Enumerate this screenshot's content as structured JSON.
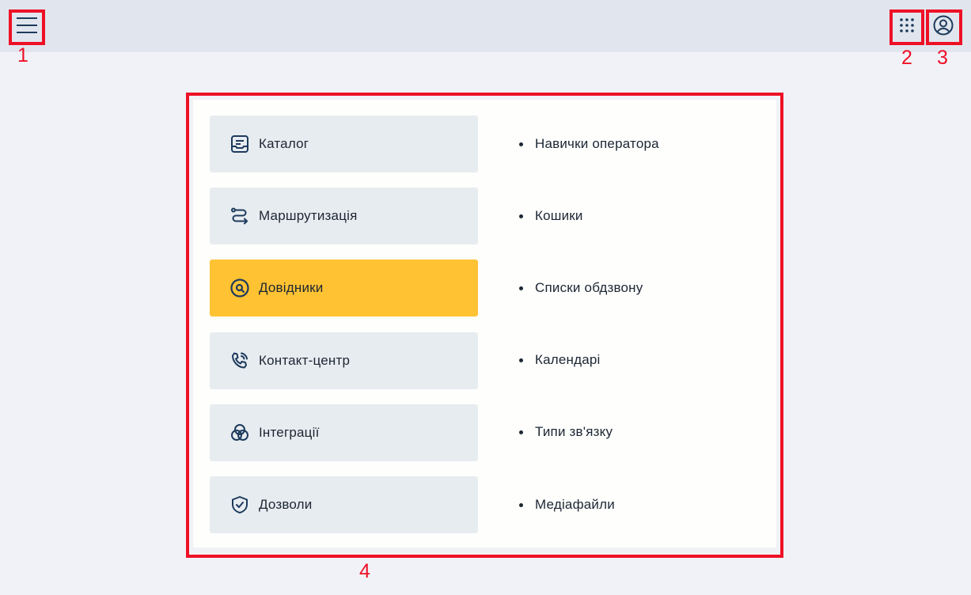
{
  "header": {
    "menu_icon": "hamburger-menu-icon",
    "apps_icon": "apps-grid-icon",
    "profile_icon": "user-profile-icon"
  },
  "annotations": [
    "1",
    "2",
    "3",
    "4"
  ],
  "categories": [
    {
      "label": "Каталог",
      "icon": "catalog-icon",
      "active": false
    },
    {
      "label": "Маршрутизація",
      "icon": "routing-icon",
      "active": false
    },
    {
      "label": "Довідники",
      "icon": "directories-icon",
      "active": true
    },
    {
      "label": "Контакт-центр",
      "icon": "phone-call-icon",
      "active": false
    },
    {
      "label": "Інтеграції",
      "icon": "integrations-icon",
      "active": false
    },
    {
      "label": "Дозволи",
      "icon": "shield-check-icon",
      "active": false
    }
  ],
  "subitems": [
    {
      "label": "Навички оператора"
    },
    {
      "label": "Кошики"
    },
    {
      "label": "Списки обдзвону"
    },
    {
      "label": "Календарі"
    },
    {
      "label": "Типи зв'язку"
    },
    {
      "label": "Медіафайли"
    }
  ],
  "colors": {
    "accent": "#ffc233",
    "annotation": "#ee1126",
    "icon": "#1d3a5c"
  }
}
